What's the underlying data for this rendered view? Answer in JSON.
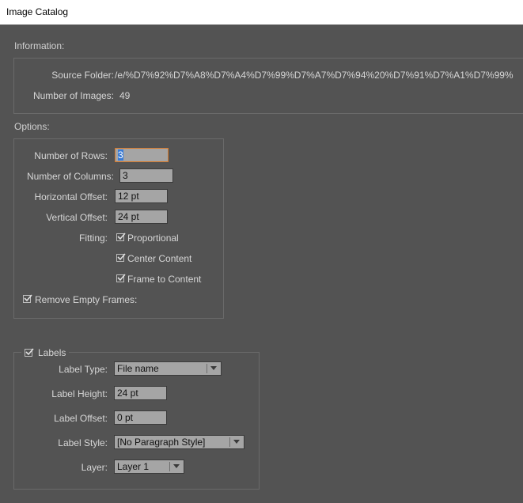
{
  "window": {
    "title": "Image Catalog"
  },
  "information": {
    "heading": "Information:",
    "source_folder_label": "Source Folder:",
    "source_folder_value": "/e/%D7%92%D7%A8%D7%A4%D7%99%D7%A7%D7%94%20%D7%91%D7%A1%D7%99%",
    "number_of_images_label": "Number of Images:",
    "number_of_images_value": "49"
  },
  "options": {
    "heading": "Options:",
    "rows_label": "Number of Rows:",
    "rows_value": "3",
    "columns_label": "Number of Columns:",
    "columns_value": "3",
    "h_offset_label": "Horizontal Offset:",
    "h_offset_value": "12 pt",
    "v_offset_label": "Vertical Offset:",
    "v_offset_value": "24 pt",
    "fitting_label": "Fitting:",
    "proportional_label": "Proportional",
    "proportional_checked": true,
    "center_content_label": "Center Content",
    "center_content_checked": true,
    "frame_to_content_label": "Frame to Content",
    "frame_to_content_checked": true,
    "remove_empty_frames_label": "Remove Empty Frames:",
    "remove_empty_frames_checked": true
  },
  "labels": {
    "heading": "Labels",
    "enabled": true,
    "label_type_label": "Label Type:",
    "label_type_value": "File name",
    "label_height_label": "Label Height:",
    "label_height_value": "24 pt",
    "label_offset_label": "Label Offset:",
    "label_offset_value": "0 pt",
    "label_style_label": "Label Style:",
    "label_style_value": "[No Paragraph Style]",
    "layer_label": "Layer:",
    "layer_value": "Layer 1"
  },
  "icons": {
    "checkmark": "checkmark-icon",
    "dropdown": "chevron-down-icon"
  }
}
